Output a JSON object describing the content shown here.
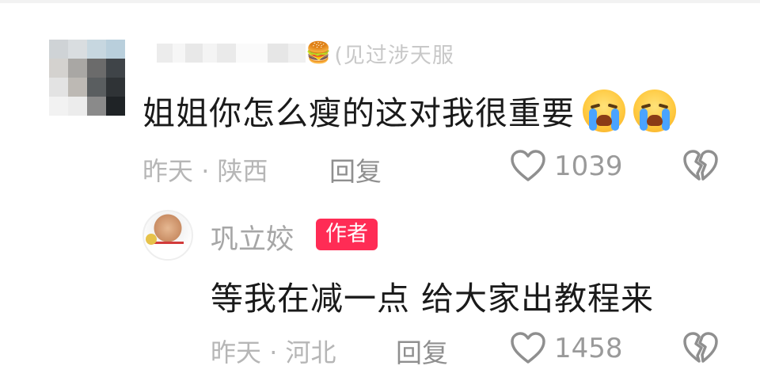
{
  "comment": {
    "username_suffix": "(见过涉天服",
    "text": "姐姐你怎么瘦的这对我很重要",
    "time": "昨天",
    "separator": "·",
    "location": "陕西",
    "reply_label": "回复",
    "likes": "1039",
    "emoji": [
      "loudly-crying-face",
      "loudly-crying-face"
    ]
  },
  "reply": {
    "author": "巩立姣",
    "badge": "作者",
    "text": "等我在减一点 给大家出教程来",
    "time": "昨天",
    "separator": "·",
    "location": "河北",
    "reply_label": "回复",
    "likes": "1458"
  },
  "colors": {
    "badge_bg": "#ff2c55",
    "meta_text": "#b6b6b6",
    "body_text": "#1a1a1a"
  }
}
